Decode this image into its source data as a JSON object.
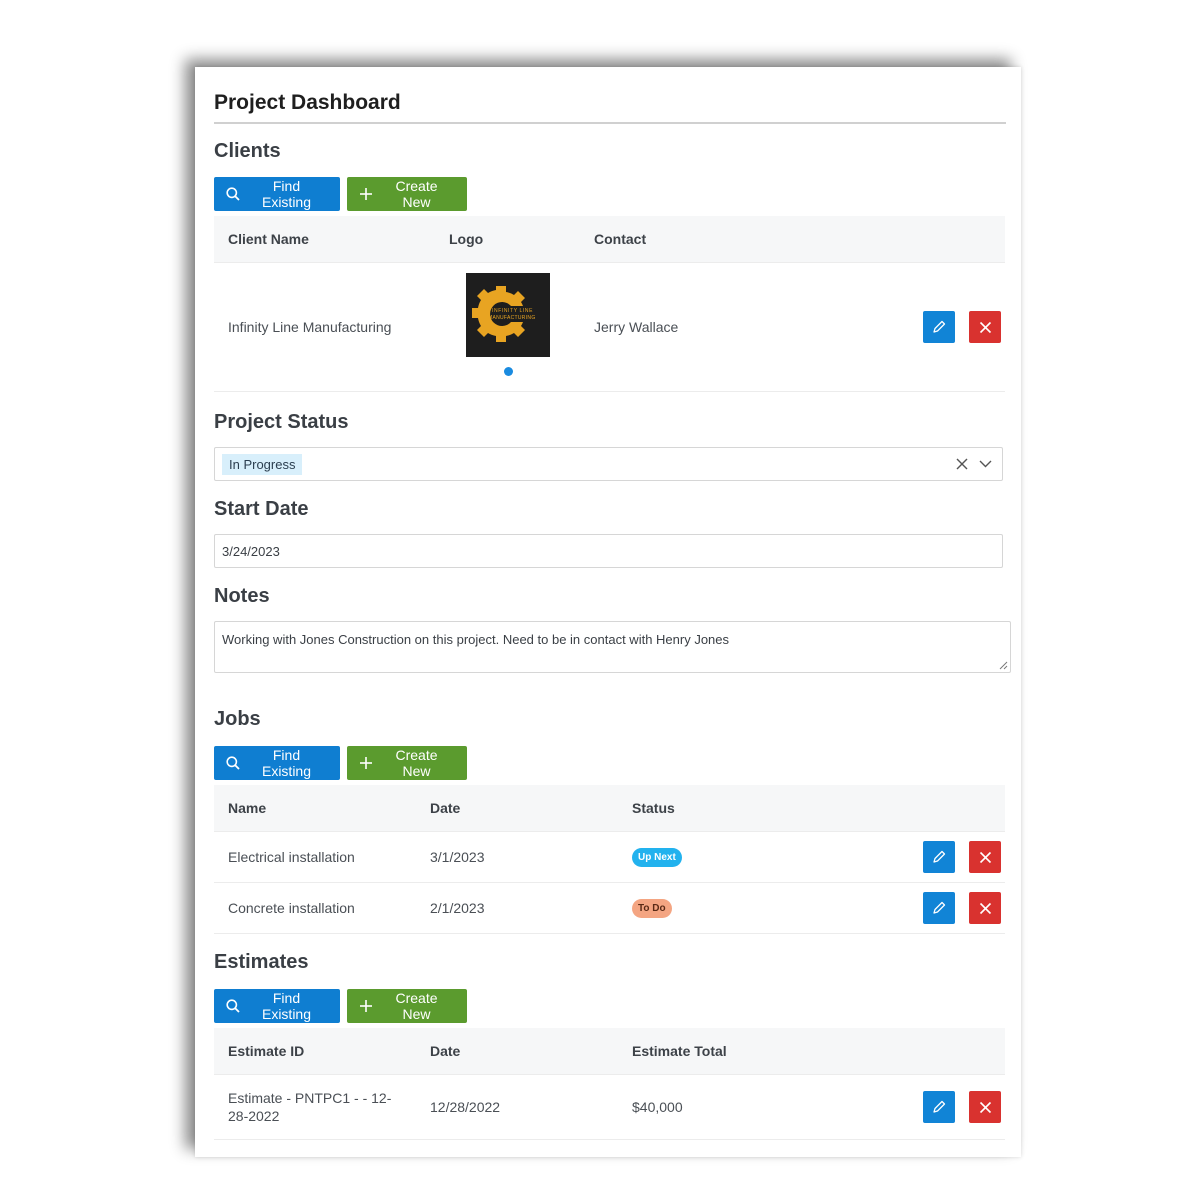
{
  "page": {
    "title": "Project Dashboard"
  },
  "clients": {
    "title": "Clients",
    "find_label": "Find Existing",
    "create_label": "Create New",
    "columns": [
      "Client Name",
      "Logo",
      "Contact"
    ],
    "rows": [
      {
        "name": "Infinity Line Manufacturing",
        "logo_text_1": "INFINITY LINE",
        "logo_text_2": "MANUFACTURING",
        "contact": "Jerry Wallace"
      }
    ]
  },
  "status": {
    "title": "Project Status",
    "value": "In Progress"
  },
  "start_date": {
    "title": "Start Date",
    "value": "3/24/2023"
  },
  "notes": {
    "title": "Notes",
    "value": "Working with Jones Construction on this project. Need to be in contact with Henry Jones"
  },
  "jobs": {
    "title": "Jobs",
    "find_label": "Find Existing",
    "create_label": "Create New",
    "columns": [
      "Name",
      "Date",
      "Status"
    ],
    "rows": [
      {
        "name": "Electrical installation",
        "date": "3/1/2023",
        "status": "Up Next",
        "status_color": "#22b2ee"
      },
      {
        "name": "Concrete installation",
        "date": "2/1/2023",
        "status": "To Do",
        "status_color": "#f4a582"
      }
    ]
  },
  "estimates": {
    "title": "Estimates",
    "find_label": "Find Existing",
    "create_label": "Create New",
    "columns": [
      "Estimate ID",
      "Date",
      "Estimate Total"
    ],
    "rows": [
      {
        "id_line1": "Estimate - PNTPC1 - - 12-",
        "id_line2": "28-2022",
        "date": "12/28/2022",
        "total": "$40,000"
      }
    ]
  },
  "colors": {
    "primary": "#0f7ed1",
    "success": "#5b9b2e",
    "danger": "#d9322f",
    "logo_gear": "#e8a422"
  },
  "icons": {
    "find": "search-icon",
    "create": "plus-icon",
    "edit": "pencil-icon",
    "delete": "close-icon",
    "clear": "clear-icon",
    "dropdown": "chevron-down-icon"
  }
}
